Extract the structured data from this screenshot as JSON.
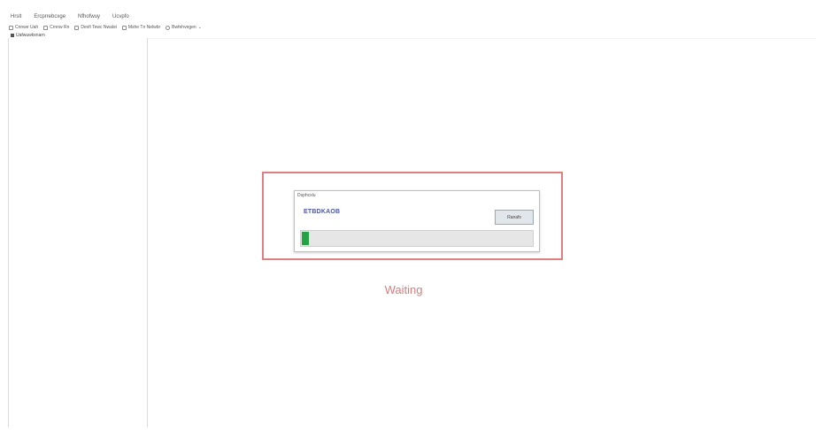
{
  "menu": {
    "items": [
      "Hrslt",
      "Ercprrebcxge",
      "Nfhofwuy",
      "Ucvpfo"
    ]
  },
  "toolbar": {
    "items": [
      {
        "icon": "window-icon",
        "label": "Cnnwe Uah"
      },
      {
        "icon": "window-icon",
        "label": "Crnnw Rn"
      },
      {
        "icon": "window-icon",
        "label": "Dexfi Tewc Nwalst"
      },
      {
        "icon": "person-icon",
        "label": "Mshe Tn Nelwbr"
      },
      {
        "icon": "globe-icon",
        "label": "Bwfehvegen"
      }
    ],
    "dropdown_caret": "⌄"
  },
  "tree": {
    "root_label": "Uafwuwkxnarn"
  },
  "dialog": {
    "title": "Dsphcxlu",
    "name": "ETBDKAOB",
    "button_label": "Ranafs",
    "progress": 0.03
  },
  "status": {
    "text": "Waiting"
  },
  "colors": {
    "frame_border": "#e07f80",
    "progress_fill": "#25a244",
    "status_text": "#d97b7b",
    "name_text": "#4b56a8"
  }
}
